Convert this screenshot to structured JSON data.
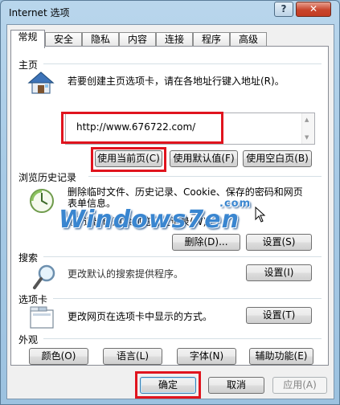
{
  "window": {
    "title": "Internet 选项",
    "help_label": "?",
    "close_label": "✕"
  },
  "tabs": [
    "常规",
    "安全",
    "隐私",
    "内容",
    "连接",
    "程序",
    "高级"
  ],
  "home": {
    "group_label": "主页",
    "description": "若要创建主页选项卡，请在各地址行键入地址(R)。",
    "url": "http://www.676722.com/",
    "use_current": "使用当前页(C)",
    "use_default": "使用默认值(F)",
    "use_blank": "使用空白页(B)"
  },
  "history": {
    "group_label": "浏览历史记录",
    "description_line1": "删除临时文件、历史记录、Cookie、保存的密码和网页",
    "description_line2": "表单信息。",
    "checkbox_label": "退出时删除浏览历史记录(W)",
    "checkbox_checked": false,
    "delete_button": "删除(D)...",
    "settings_button": "设置(S)"
  },
  "search": {
    "group_label": "搜索",
    "description": "更改默认的搜索提供程序。",
    "settings_button": "设置(I)"
  },
  "tabs_section": {
    "group_label": "选项卡",
    "description": "更改网页在选项卡中显示的方式。",
    "settings_button": "设置(T)"
  },
  "appearance": {
    "group_label": "外观",
    "colors_button": "颜色(O)",
    "languages_button": "语言(L)",
    "fonts_button": "字体(N)",
    "accessibility_button": "辅助功能(E)"
  },
  "footer": {
    "ok_button": "确定",
    "cancel_button": "取消",
    "apply_button": "应用(A)"
  },
  "watermark": {
    "text": "Windows7en",
    "suffix": ".com"
  },
  "colors": {
    "highlight_box": "#e0141e",
    "frame": "#a8cbe6"
  }
}
